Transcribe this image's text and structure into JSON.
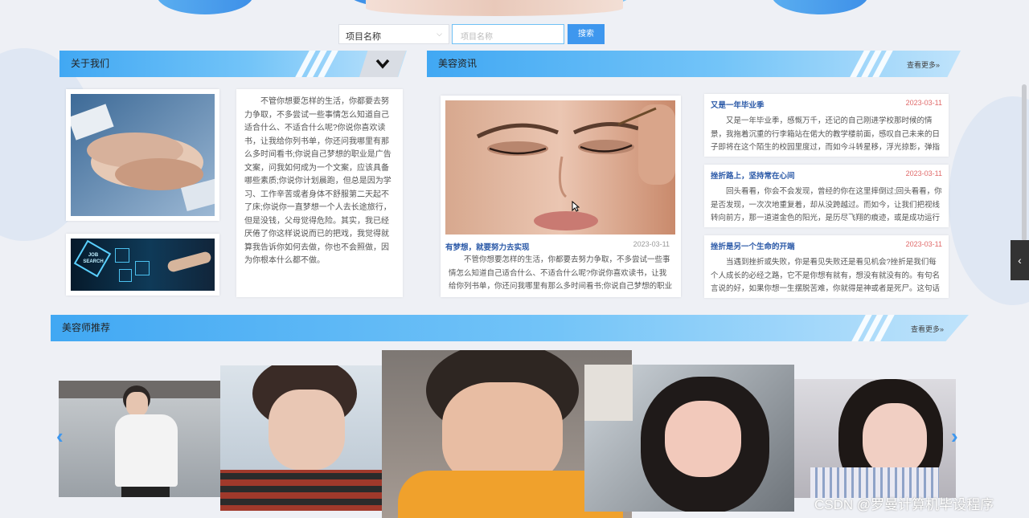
{
  "search": {
    "select_value": "项目名称",
    "input_placeholder": "项目名称",
    "button_label": "搜索"
  },
  "about": {
    "title": "关于我们",
    "text": "不管你想要怎样的生活，你都要去努力争取，不多尝试一些事情怎么知道自己适合什么、不适合什么呢?你说你喜欢读书，让我给你列书单，你还问我哪里有那么多时间看书;你说自己梦想的职业是广告文案，问我如何成为一个文案，应该具备哪些素质;你说你计划晨跑，但总是因为学习、工作辛苦或者身体不舒服第二天起不了床;你说你一直梦想一个人去长途旅行，但是没钱，父母觉得危险。其实，我已经厌倦了你这样说说而已的把戏，我觉得就算我告诉你如何去做，你也不会照做，因为你根本什么都不做。",
    "image2_text": "JOB SEARCH"
  },
  "news": {
    "title": "美容资讯",
    "more": "查看更多»",
    "main": {
      "title": "有梦想，就要努力去实现",
      "date": "2023-03-11",
      "body": "不管你想要怎样的生活，你都要去努力争取，不多尝试一些事情怎么知道自己适合什么、不适合什么呢?你说你喜欢读书，让我给你列书单，你还问我哪里有那么多时间看书;你说自己梦想的职业是"
    },
    "items": [
      {
        "title": "又是一年毕业季",
        "date": "2023-03-11",
        "body": "又是一年毕业季，感慨万千，还记的自己刚进学校那时候的情景，我拖着沉重的行李箱站在偌大的教学楼前面，感叹自己未来的日子即将在这个陌生的校园里度过，而如今斗转星移，浮光掠影，弹指之间，那"
      },
      {
        "title": "挫折路上，坚持常在心间",
        "date": "2023-03-11",
        "body": "回头看看，你会不会发现，曾经的你在这里摔倒过;回头看看，你是否发现，一次次地重复着，却从没跨越过。而如今，让我们把视线转向前方，那一道道金色的阳光，是历尽飞翔的痕迹，或是成功运行的轨"
      },
      {
        "title": "挫折是另一个生命的开端",
        "date": "2023-03-11",
        "body": "当遇到挫折或失败，你是看见失败还是看见机会?挫折是我们每个人成长的必经之路，它不是你想有就有，想没有就没有的。有句名言说的好，如果你想一生摆脱苦难，你就得是神或者是死尸。这句话形象地"
      }
    ]
  },
  "beauticians": {
    "title": "美容师推荐",
    "more": "查看更多»"
  },
  "side_tab": "‹",
  "watermark": "CSDN @罗曼计算机毕设程序",
  "colors": {
    "accent": "#3e97ee",
    "title_blue": "#2c5aa8",
    "date_red": "#e06a6a"
  }
}
